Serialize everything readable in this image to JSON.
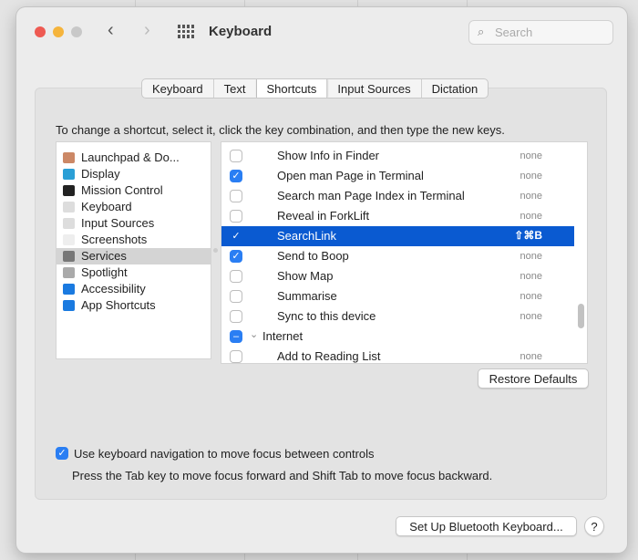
{
  "window": {
    "title": "Keyboard",
    "search_placeholder": "Search"
  },
  "tabs": [
    "Keyboard",
    "Text",
    "Shortcuts",
    "Input Sources",
    "Dictation"
  ],
  "selected_tab": "Shortcuts",
  "instruction": "To change a shortcut, select it, click the key combination, and then type the new keys.",
  "categories": [
    {
      "label": "Launchpad & Do...",
      "icon": "launchpad-icon",
      "color": "#c86"
    },
    {
      "label": "Display",
      "icon": "display-icon",
      "color": "#2a9fd6"
    },
    {
      "label": "Mission Control",
      "icon": "mission-control-icon",
      "color": "#222"
    },
    {
      "label": "Keyboard",
      "icon": "keyboard-icon",
      "color": "#ddd"
    },
    {
      "label": "Input Sources",
      "icon": "input-sources-icon",
      "color": "#ddd"
    },
    {
      "label": "Screenshots",
      "icon": "screenshots-icon",
      "color": "#eee"
    },
    {
      "label": "Services",
      "icon": "gear-icon",
      "color": "#777"
    },
    {
      "label": "Spotlight",
      "icon": "spotlight-icon",
      "color": "#aaa"
    },
    {
      "label": "Accessibility",
      "icon": "accessibility-icon",
      "color": "#1a7ae0"
    },
    {
      "label": "App Shortcuts",
      "icon": "app-shortcuts-icon",
      "color": "#1a7ae0"
    }
  ],
  "selected_category": "Services",
  "shortcuts": [
    {
      "label": "Show Info in Finder",
      "checked": false,
      "key": "none"
    },
    {
      "label": "Open man Page in Terminal",
      "checked": true,
      "key": "none"
    },
    {
      "label": "Search man Page Index in Terminal",
      "checked": false,
      "key": "none"
    },
    {
      "label": "Reveal in ForkLift",
      "checked": false,
      "key": "none"
    },
    {
      "label": "SearchLink",
      "checked": true,
      "key": "⇧⌘B",
      "selected": true
    },
    {
      "label": "Send to Boop",
      "checked": true,
      "key": "none"
    },
    {
      "label": "Show Map",
      "checked": false,
      "key": "none"
    },
    {
      "label": "Summarise",
      "checked": false,
      "key": "none"
    },
    {
      "label": "Sync to this device",
      "checked": false,
      "key": "none"
    },
    {
      "label": "Internet",
      "group": true,
      "mixed": true
    },
    {
      "label": "Add to Reading List",
      "checked": false,
      "key": "none"
    }
  ],
  "restore_defaults": "Restore Defaults",
  "keyboard_nav": {
    "label": "Use keyboard navigation to move focus between controls",
    "checked": true,
    "hint": "Press the Tab key to move focus forward and Shift Tab to move focus backward."
  },
  "bluetooth_button": "Set Up Bluetooth Keyboard...",
  "help": "?"
}
